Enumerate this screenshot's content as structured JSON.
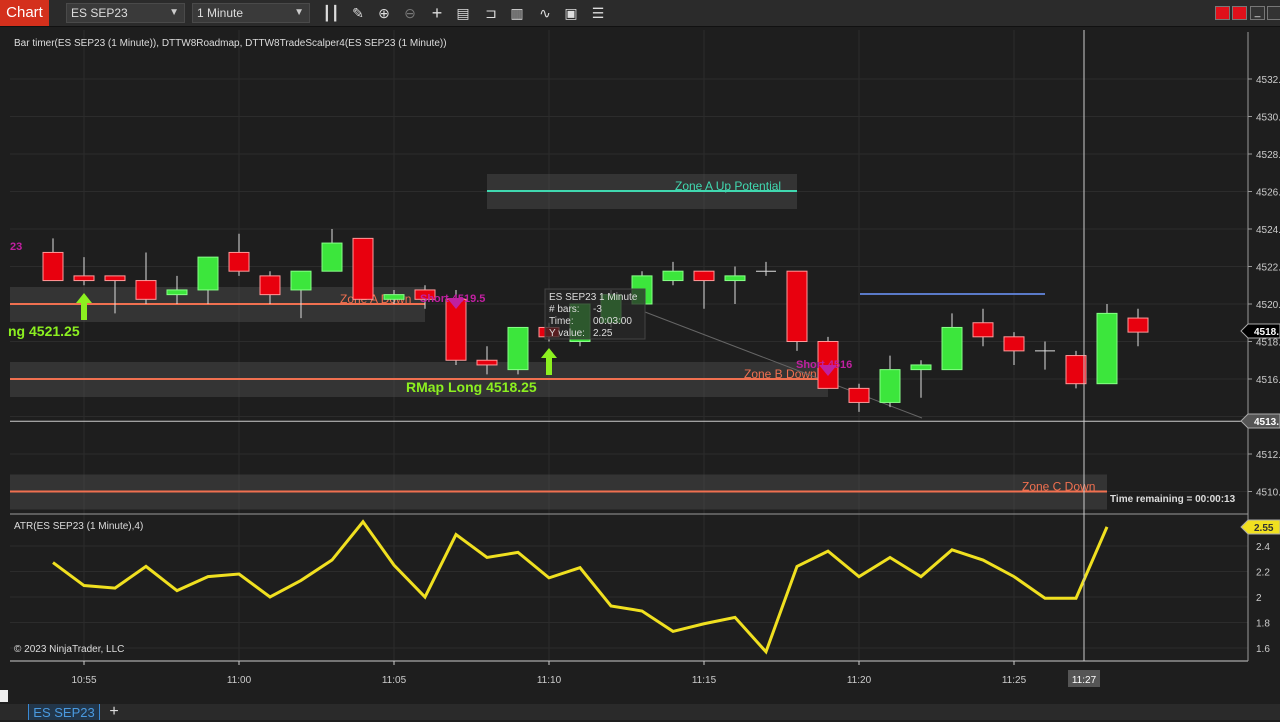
{
  "toolbar": {
    "chart_label": "Chart",
    "instrument": "ES SEP23",
    "interval": "1 Minute",
    "icons": [
      "bar-type-icon",
      "pencil-draw-icon",
      "zoom-in-icon",
      "zoom-out-icon",
      "crosshair-icon",
      "properties-icon",
      "templates-icon",
      "data-series-icon",
      "strategies-icon",
      "indicators-icon",
      "objects-list-icon"
    ]
  },
  "chart": {
    "indicators_label": "Bar timer(ES SEP23 (1 Minute)), DTTW8Roadmap, DTTW8TradeScalper4(ES SEP23 (1 Minute))",
    "price_ticks": [
      "4532.",
      "4530.",
      "4528.",
      "4526.",
      "4524.",
      "4522.",
      "4520.",
      "4518.",
      "4516.",
      "4514.",
      "4512.",
      "4510."
    ],
    "price_tick_values": [
      4532,
      4530,
      4528,
      4526,
      4524,
      4522,
      4520,
      4518,
      4516,
      4514,
      4512,
      4510
    ],
    "last_price_marker": "4518.",
    "crosshair_price_marker": "4513.",
    "crosshair_price": 4513.75,
    "time_ticks": [
      "10:55",
      "11:00",
      "11:05",
      "11:10",
      "11:15",
      "11:20",
      "11:25"
    ],
    "crosshair_time": "11:27",
    "time_remaining": "Time remaining = 00:00:13",
    "copyright": "© 2023 NinjaTrader, LLC",
    "colors": {
      "up": "#3ce63c",
      "down": "#e8000e",
      "zone_line": "#f07050",
      "zone_up_line": "#40d8b0",
      "short_label": "#c020a0",
      "long_label": "#8cf020",
      "atr": "#f0e020"
    },
    "candles": [
      [
        4522.75,
        4523.5,
        4521.25,
        4521.25
      ],
      [
        4521.5,
        4522.5,
        4521.0,
        4521.25
      ],
      [
        4521.5,
        4521.5,
        4519.5,
        4521.25
      ],
      [
        4521.25,
        4522.75,
        4520.0,
        4520.25
      ],
      [
        4520.5,
        4521.5,
        4520.0,
        4520.75
      ],
      [
        4520.75,
        4522.5,
        4520.0,
        4522.5
      ],
      [
        4522.75,
        4523.75,
        4521.5,
        4521.75
      ],
      [
        4521.5,
        4521.75,
        4520.0,
        4520.5
      ],
      [
        4520.75,
        4521.75,
        4519.25,
        4521.75
      ],
      [
        4521.75,
        4524.0,
        4521.75,
        4523.25
      ],
      [
        4523.5,
        4523.5,
        4520.25,
        4520.25
      ],
      [
        4520.25,
        4520.75,
        4520.0,
        4520.5
      ],
      [
        4520.75,
        4521.0,
        4519.75,
        4520.25
      ],
      [
        4520.25,
        4520.75,
        4516.75,
        4517.0
      ],
      [
        4517.0,
        4517.75,
        4516.25,
        4516.75
      ],
      [
        4516.5,
        4518.75,
        4516.25,
        4518.75
      ],
      [
        4518.75,
        4519.0,
        4518.0,
        4518.25
      ],
      [
        4518.0,
        4520.0,
        4517.75,
        4520.0
      ],
      [
        4519.0,
        4520.75,
        4518.75,
        4520.5
      ],
      [
        4520.0,
        4521.75,
        4520.0,
        4521.5
      ],
      [
        4521.25,
        4522.25,
        4521.0,
        4521.75
      ],
      [
        4521.75,
        4521.75,
        4519.75,
        4521.25
      ],
      [
        4521.25,
        4522.0,
        4520.0,
        4521.5
      ],
      [
        4521.75,
        4522.25,
        4521.5,
        4521.75
      ],
      [
        4521.75,
        4521.75,
        4517.5,
        4518.0
      ],
      [
        4518.0,
        4518.25,
        4515.5,
        4515.5
      ],
      [
        4515.5,
        4515.75,
        4514.25,
        4514.75
      ],
      [
        4514.75,
        4517.25,
        4514.5,
        4516.5
      ],
      [
        4516.5,
        4517.0,
        4515.0,
        4516.75
      ],
      [
        4516.5,
        4519.5,
        4516.5,
        4518.75
      ],
      [
        4519.0,
        4519.75,
        4517.75,
        4518.25
      ],
      [
        4518.25,
        4518.5,
        4516.75,
        4517.5
      ],
      [
        4517.5,
        4518.0,
        4516.5,
        4517.5
      ],
      [
        4517.25,
        4517.5,
        4515.5,
        4515.75
      ],
      [
        4515.75,
        4520.0,
        4515.75,
        4519.5
      ],
      [
        4519.25,
        4519.75,
        4517.75,
        4518.5
      ]
    ],
    "zones": [
      {
        "label": "Zone A  Up Potential",
        "price": 4526.0,
        "type": "up"
      },
      {
        "label": "Zone A  Down",
        "price": 4520.0,
        "type": "down"
      },
      {
        "label": "Zone B  Down",
        "price": 4516.0,
        "type": "down"
      },
      {
        "label": "Zone C  Down",
        "price": 4510.0,
        "type": "down"
      }
    ],
    "signals": {
      "short_1": "Short 4519.5",
      "short_2": "Short 4516",
      "short_cut": "23",
      "long_1": "ng 4521.25",
      "long_2": "RMap Long 4518.25"
    },
    "tooltip": {
      "title": "ES SEP23 1 Minute",
      "bars_label": "# bars:",
      "bars_value": "-3",
      "time_label": "Time:",
      "time_value": "00:03:00",
      "y_label": "Y value:",
      "y_value": "2.25"
    }
  },
  "atr": {
    "label": "ATR(ES SEP23 (1 Minute),4)",
    "ticks": [
      "2.4",
      "2.2",
      "2",
      "1.8",
      "1.6"
    ],
    "tick_values": [
      2.4,
      2.2,
      2.0,
      1.8,
      1.6
    ],
    "current_marker": "2.55",
    "values": [
      2.27,
      2.09,
      2.07,
      2.24,
      2.05,
      2.16,
      2.18,
      2.0,
      2.13,
      2.29,
      2.59,
      2.25,
      2.0,
      2.49,
      2.31,
      2.35,
      2.15,
      2.23,
      1.93,
      1.89,
      1.73,
      1.79,
      1.84,
      1.57,
      2.24,
      2.36,
      2.16,
      2.31,
      2.16,
      2.37,
      2.29,
      2.16,
      1.99,
      1.99,
      2.55
    ]
  },
  "tabs": [
    {
      "label": "ES SEP23",
      "active": true
    }
  ],
  "tab_add": "+"
}
